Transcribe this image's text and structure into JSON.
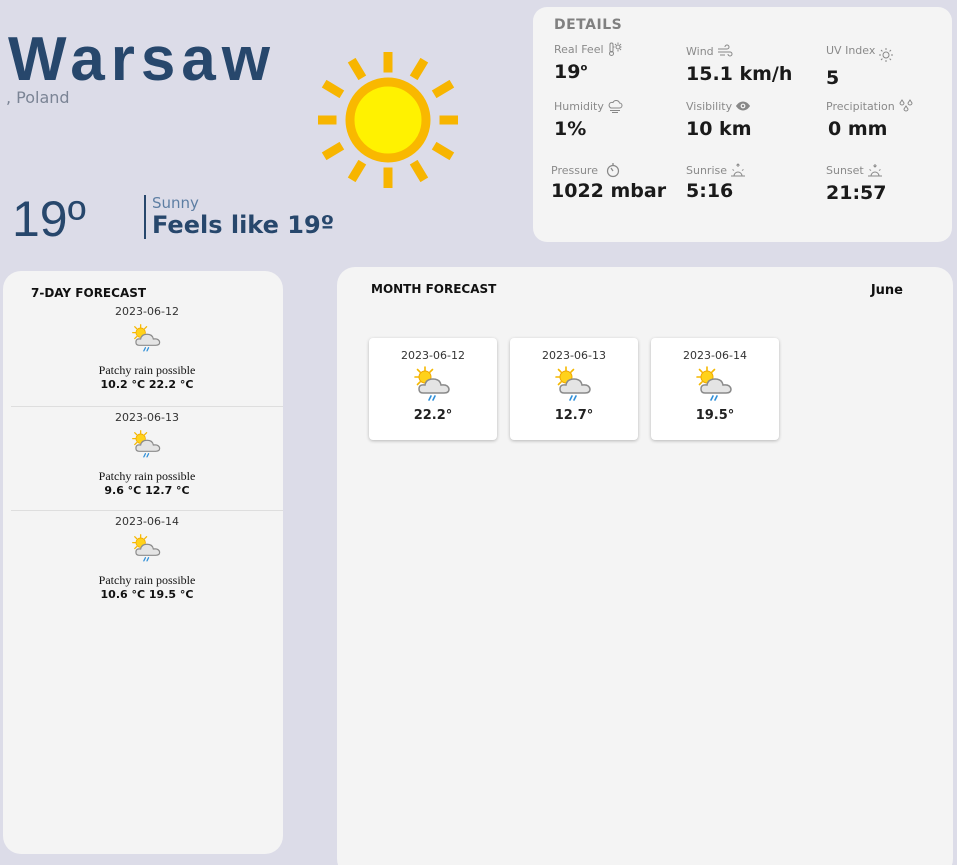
{
  "location": {
    "city": "Warsaw",
    "country": ", Poland"
  },
  "current": {
    "temp": "19º",
    "condition": "Sunny",
    "feels_like": "Feels like 19º",
    "icon": "sun-icon"
  },
  "details": {
    "title": "DETAILS",
    "items": [
      {
        "label": "Real Feel",
        "value": "19",
        "unit": "o",
        "icon": "thermometer-sun-icon"
      },
      {
        "label": "Wind",
        "value": "15.1 km/h",
        "icon": "wind-icon"
      },
      {
        "label": "UV Index",
        "value": "5",
        "icon": "sun-small-icon"
      },
      {
        "label": "Humidity",
        "value": "1%",
        "icon": "cloud-icon"
      },
      {
        "label": "Visibility",
        "value": "10 km",
        "icon": "eye-icon"
      },
      {
        "label": "Precipitation",
        "value": "0 mm",
        "icon": "droplets-icon"
      },
      {
        "label": "Pressure",
        "value": "1022 mbar",
        "icon": "gauge-icon"
      },
      {
        "label": "Sunrise",
        "value": "5:16",
        "icon": "sunrise-icon"
      },
      {
        "label": "Sunset",
        "value": "21:57",
        "icon": "sunset-icon"
      }
    ]
  },
  "week_forecast": {
    "title": "7-DAY FORECAST",
    "days": [
      {
        "date": "2023-06-12",
        "desc": "Patchy rain possible",
        "temps": "10.2 °C  22.2 °C",
        "icon": "patchy-rain-icon"
      },
      {
        "date": "2023-06-13",
        "desc": "Patchy rain possible",
        "temps": "9.6 °C  12.7 °C",
        "icon": "patchy-rain-icon"
      },
      {
        "date": "2023-06-14",
        "desc": "Patchy rain possible",
        "temps": "10.6 °C  19.5 °C",
        "icon": "patchy-rain-icon"
      }
    ]
  },
  "month_forecast": {
    "title": "MONTH FORECAST",
    "month": "June",
    "days": [
      {
        "date": "2023-06-12",
        "temp": "22.2°",
        "icon": "patchy-rain-icon"
      },
      {
        "date": "2023-06-13",
        "temp": "12.7°",
        "icon": "patchy-rain-icon"
      },
      {
        "date": "2023-06-14",
        "temp": "19.5°",
        "icon": "patchy-rain-icon"
      }
    ]
  },
  "colors": {
    "primary": "#27476c",
    "background": "#dcdce8",
    "panel": "#f4f4f4",
    "sun": "#f5c400"
  }
}
